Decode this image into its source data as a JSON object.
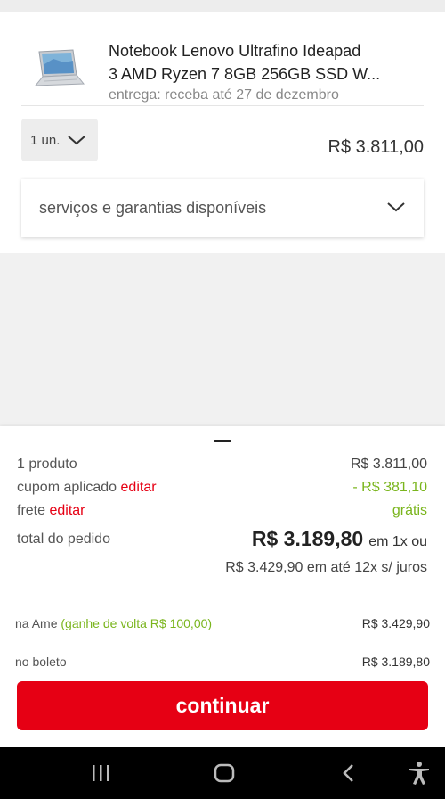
{
  "product": {
    "name_line1": "Notebook Lenovo Ultrafino Ideapad",
    "name_line2": "3 AMD Ryzen 7 8GB 256GB SSD W...",
    "delivery": "entrega: receba até 27 de dezembro",
    "quantity": "1 un.",
    "price": "R$ 3.811,00"
  },
  "services": {
    "label": "serviços e garantias disponíveis"
  },
  "summary": {
    "products_label": "1 produto",
    "products_value": "R$ 3.811,00",
    "coupon_label": "cupom aplicado",
    "coupon_edit": "editar",
    "coupon_value": "- R$ 381,10",
    "shipping_label": "frete",
    "shipping_edit": "editar",
    "shipping_value": "grátis",
    "total_label": "total do pedido",
    "total_value": "R$ 3.189,80",
    "total_suffix": "em 1x ou",
    "installments": "R$ 3.429,90 em até 12x s/ juros",
    "ame_label": "na Ame",
    "ame_cashback": "(ganhe de volta R$ 100,00)",
    "ame_value": "R$ 3.429,90",
    "boleto_label": "no boleto",
    "boleto_value": "R$ 3.189,80"
  },
  "cta": {
    "label": "continuar"
  },
  "colors": {
    "accent": "#e60014",
    "success": "#7ab51d"
  },
  "navbar": {
    "icons": [
      "recents-icon",
      "home-icon",
      "back-icon",
      "accessibility-icon"
    ]
  }
}
